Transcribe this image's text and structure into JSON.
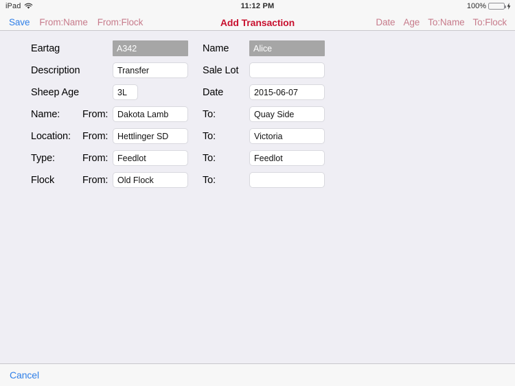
{
  "status_bar": {
    "device": "iPad",
    "wifi_icon": "wifi-icon",
    "time": "11:12 PM",
    "battery_percent": "100%",
    "battery_icon": "battery-icon",
    "charging_icon": "lightning-bolt-icon"
  },
  "toolbar": {
    "title": "Add Transaction",
    "save_label": "Save",
    "left_buttons": [
      {
        "label": "From:Name",
        "name": "from-name-button"
      },
      {
        "label": "From:Flock",
        "name": "from-flock-button"
      }
    ],
    "right_buttons": [
      {
        "label": "Date",
        "name": "date-button"
      },
      {
        "label": "Age",
        "name": "age-button"
      },
      {
        "label": "To:Name",
        "name": "to-name-button"
      },
      {
        "label": "To:Flock",
        "name": "to-flock-button"
      }
    ],
    "colors": {
      "save": "#2f7fe8",
      "muted_action": "#c77b8b",
      "title": "#c8102e"
    }
  },
  "form": {
    "rows": [
      {
        "left_label": "Eartag",
        "left_value": "A342",
        "left_disabled": true,
        "right_label": "Name",
        "right_value": "Alice",
        "right_disabled": true
      },
      {
        "left_label": "Description",
        "left_value": "Transfer",
        "left_disabled": false,
        "right_label": "Sale Lot",
        "right_value": "",
        "right_disabled": false
      },
      {
        "left_label": "Sheep Age",
        "left_value": "3L",
        "left_disabled": false,
        "right_label": "Date",
        "right_value": "2015-06-07",
        "right_disabled": false
      }
    ],
    "transfer_rows": [
      {
        "label": "Name:",
        "from_label": "From:",
        "from_value": "Dakota Lamb",
        "to_label": "To:",
        "to_value": "Quay Side"
      },
      {
        "label": "Location:",
        "from_label": "From:",
        "from_value": "Hettlinger SD",
        "to_label": "To:",
        "to_value": "Victoria"
      },
      {
        "label": "Type:",
        "from_label": "From:",
        "from_value": "Feedlot",
        "to_label": "To:",
        "to_value": "Feedlot"
      },
      {
        "label": "Flock",
        "from_label": "From:",
        "from_value": "Old Flock",
        "to_label": "To:",
        "to_value": ""
      }
    ]
  },
  "footer": {
    "cancel_label": "Cancel"
  }
}
